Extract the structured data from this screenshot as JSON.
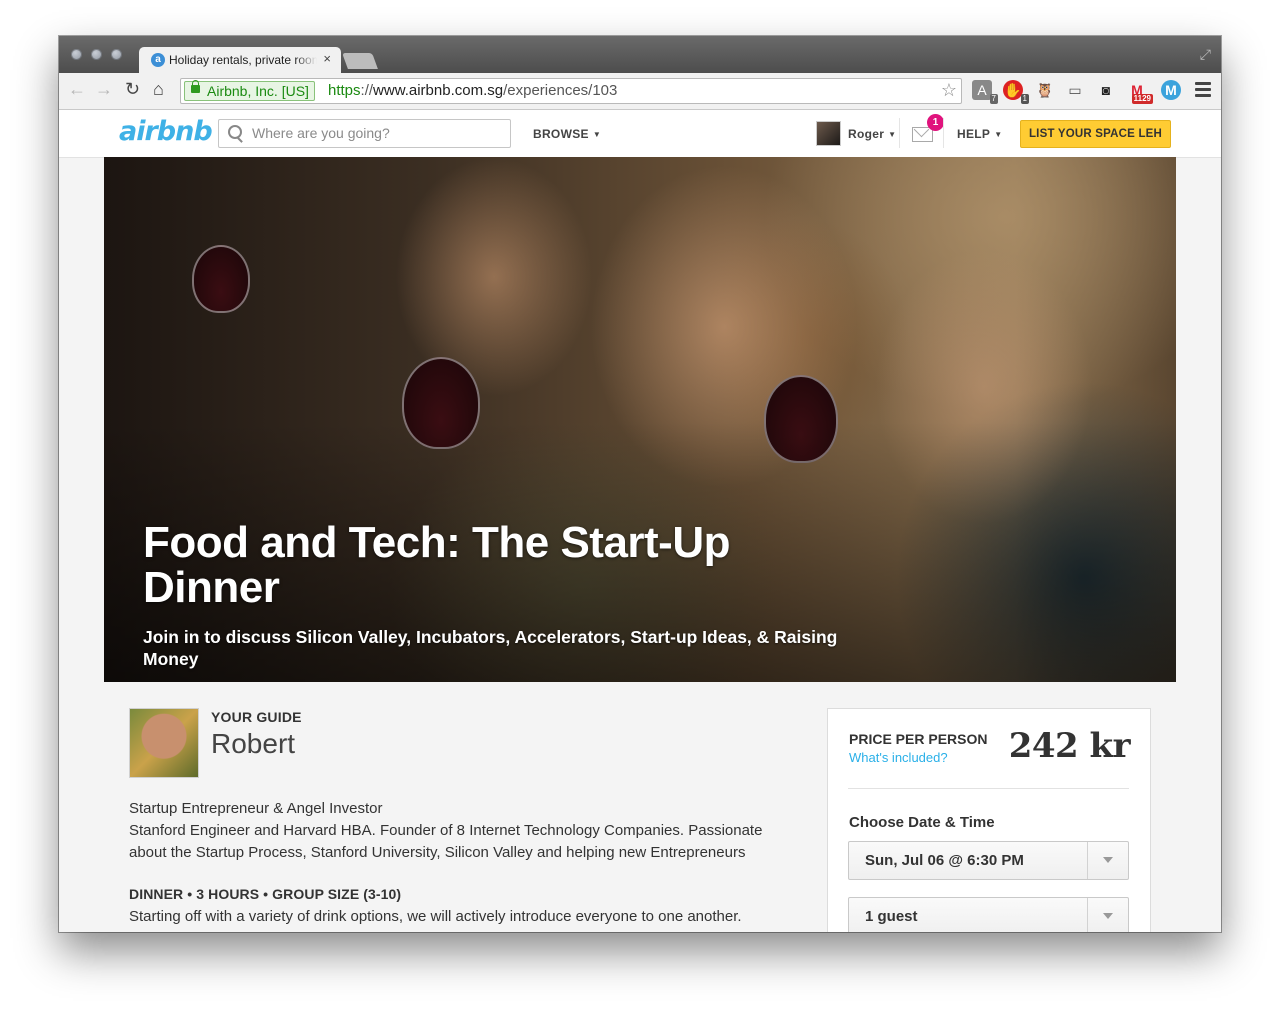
{
  "browser": {
    "tab_title": "Holiday rentals, private room",
    "tab_close": "×",
    "ev_label": "Airbnb, Inc. [US]",
    "url_scheme": "https",
    "url_sep": "://",
    "url_host": "www.airbnb.com.sg",
    "url_path": "/experiences/103",
    "extension_badges": {
      "a": "7",
      "b": "1",
      "gmail": "1129"
    }
  },
  "header": {
    "logo": "airbnb",
    "search_placeholder": "Where are you going?",
    "browse": "BROWSE",
    "user": "Roger",
    "messages_count": "1",
    "help": "HELP",
    "list_space": "LIST YOUR SPACE LEH"
  },
  "hero": {
    "title": "Food and Tech: The Start-Up Dinner",
    "subtitle": "Join in to discuss Silicon Valley, Incubators, Accelerators, Start-up Ideas, & Raising Money"
  },
  "guide": {
    "label": "YOUR GUIDE",
    "name": "Robert",
    "bio": [
      "Startup Entrepreneur & Angel Investor",
      "Stanford Engineer and Harvard HBA. Founder of 8 Internet Technology Companies. Passionate about the Startup Process, Stanford University, Silicon Valley and helping new Entrepreneurs"
    ]
  },
  "details": {
    "title": "DINNER • 3 HOURS • GROUP SIZE (3-10)",
    "text": "Starting off with a variety of drink options, we will actively introduce everyone to one another."
  },
  "booking": {
    "price_label": "PRICE PER PERSON",
    "whats_included": "What's included?",
    "price": "242 kr",
    "choose_label": "Choose Date & Time",
    "date_value": "Sun, Jul 06 @ 6:30 PM",
    "guests_value": "1 guest"
  }
}
